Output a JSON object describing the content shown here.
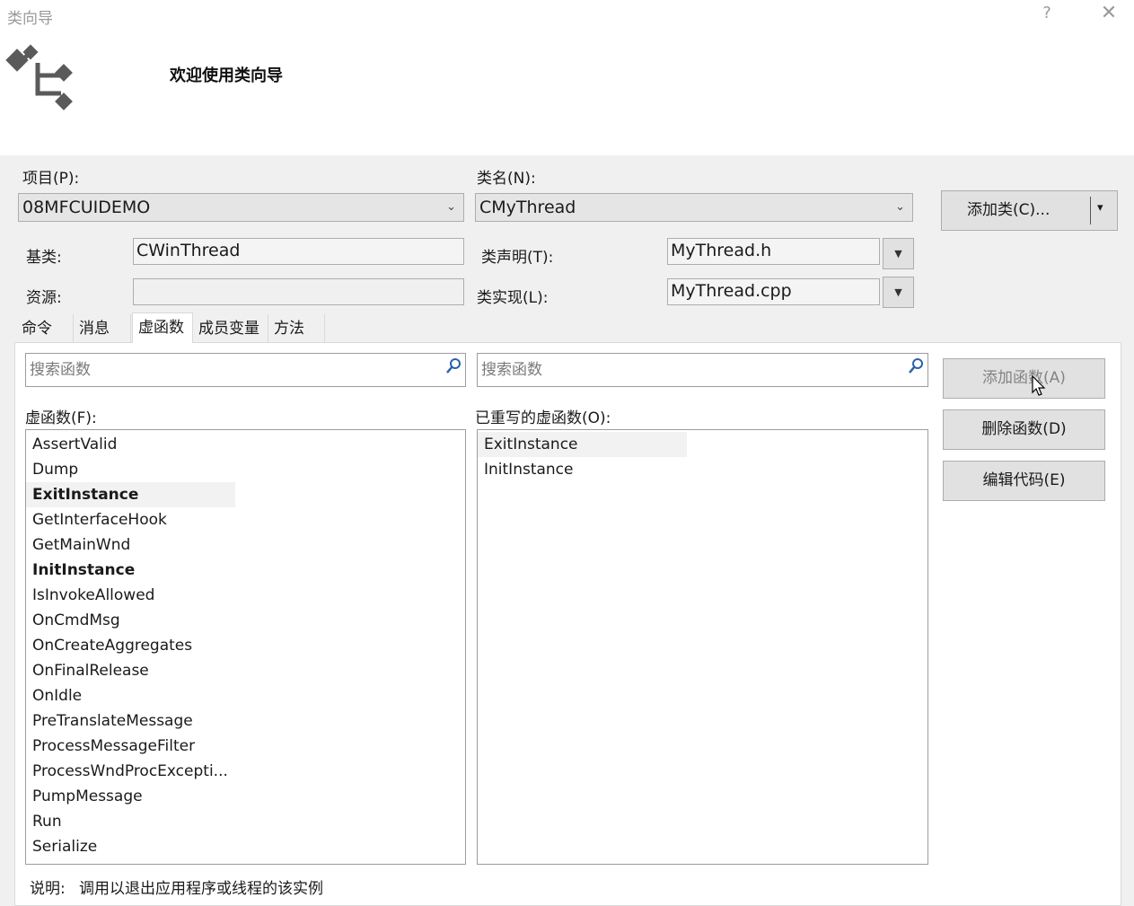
{
  "window": {
    "title": "类向导",
    "help_label": "?",
    "close_label": "✕"
  },
  "header": {
    "welcome": "欢迎使用类向导",
    "icon": "class-wizard-icon"
  },
  "project": {
    "label": "项目(P):",
    "value": "08MFCUIDEMO"
  },
  "class_name": {
    "label": "类名(N):",
    "value": "CMyThread"
  },
  "add_class_button": {
    "label": "添加类(C)...",
    "arrow": "▾"
  },
  "base_class": {
    "label": "基类:",
    "value": "CWinThread"
  },
  "resource": {
    "label": "资源:",
    "value": ""
  },
  "class_decl": {
    "label": "类声明(T):",
    "value": "MyThread.h"
  },
  "class_impl": {
    "label": "类实现(L):",
    "value": "MyThread.cpp"
  },
  "tabs": [
    {
      "label": "命令"
    },
    {
      "label": "消息"
    },
    {
      "label": "虚函数"
    },
    {
      "label": "成员变量"
    },
    {
      "label": "方法"
    }
  ],
  "active_tab": "虚函数",
  "left_search": {
    "placeholder": "搜索函数"
  },
  "right_search": {
    "placeholder": "搜索函数"
  },
  "virtual_functions": {
    "label": "虚函数(F):",
    "items": [
      {
        "name": "AssertValid",
        "bold": false
      },
      {
        "name": "Dump",
        "bold": false
      },
      {
        "name": "ExitInstance",
        "bold": true,
        "selected": true
      },
      {
        "name": "GetInterfaceHook",
        "bold": false
      },
      {
        "name": "GetMainWnd",
        "bold": false
      },
      {
        "name": "InitInstance",
        "bold": true
      },
      {
        "name": "IsInvokeAllowed",
        "bold": false
      },
      {
        "name": "OnCmdMsg",
        "bold": false
      },
      {
        "name": "OnCreateAggregates",
        "bold": false
      },
      {
        "name": "OnFinalRelease",
        "bold": false
      },
      {
        "name": "OnIdle",
        "bold": false
      },
      {
        "name": "PreTranslateMessage",
        "bold": false
      },
      {
        "name": "ProcessMessageFilter",
        "bold": false
      },
      {
        "name": "ProcessWndProcExcepti...",
        "bold": false
      },
      {
        "name": "PumpMessage",
        "bold": false
      },
      {
        "name": "Run",
        "bold": false
      },
      {
        "name": "Serialize",
        "bold": false
      }
    ]
  },
  "overridden_functions": {
    "label": "已重写的虚函数(O):",
    "items": [
      {
        "name": "ExitInstance",
        "selected": true
      },
      {
        "name": "InitInstance"
      }
    ]
  },
  "buttons": {
    "add_function": "添加函数(A)",
    "delete_function": "删除函数(D)",
    "edit_code": "编辑代码(E)"
  },
  "description": {
    "label": "说明:",
    "text": "调用以退出应用程序或线程的该实例"
  },
  "colors": {
    "panel_bg": "#f0f0f0",
    "selected_bg": "#f2f2f2",
    "disabled_text": "#838383"
  }
}
